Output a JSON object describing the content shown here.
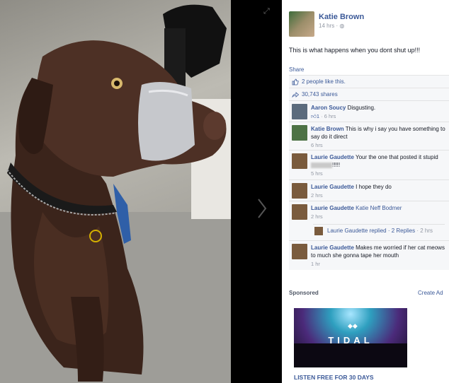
{
  "post": {
    "author": "Katie Brown",
    "time": "14 hrs",
    "privacy_icon": "globe-icon",
    "text": "This is what happens when you dont shut up!!!",
    "share_label": "Share"
  },
  "ufi": {
    "likes": "2 people like this.",
    "shares": "30,743 shares"
  },
  "comments": [
    {
      "name": "Aaron Soucy",
      "text": "Disgusting.",
      "likes": "1",
      "time": "6 hrs",
      "avatar_color": "#5b6b7d"
    },
    {
      "name": "Katie Brown",
      "text": "This is why i say you have something to say do it direct",
      "time": "6 hrs",
      "avatar_color": "#4d7245"
    },
    {
      "name": "Laurie Gaudette",
      "text": "Your the one that posted it stupid",
      "text_tail": "!!!!!",
      "time": "5 hrs",
      "avatar_color": "#7a5b3d"
    },
    {
      "name": "Laurie Gaudette",
      "text": "I hope they do",
      "time": "2 hrs",
      "avatar_color": "#7a5b3d"
    },
    {
      "name": "Laurie Gaudette",
      "text": "Katie Neff Bodmer",
      "time": "2 hrs",
      "avatar_color": "#7a5b3d",
      "reply": {
        "text": "Laurie Gaudette replied · 2 Replies",
        "time": "· 2 hrs"
      }
    },
    {
      "name": "Laurie Gaudette",
      "text": "Makes me worried if her cat meows to much she gonna tape her mouth",
      "time": "1 hr",
      "avatar_color": "#7a5b3d"
    }
  ],
  "ads": {
    "sponsored_label": "Sponsored",
    "create_ad_label": "Create Ad",
    "brand": "TIDAL",
    "cta": "LISTEN FREE FOR 30 DAYS"
  }
}
